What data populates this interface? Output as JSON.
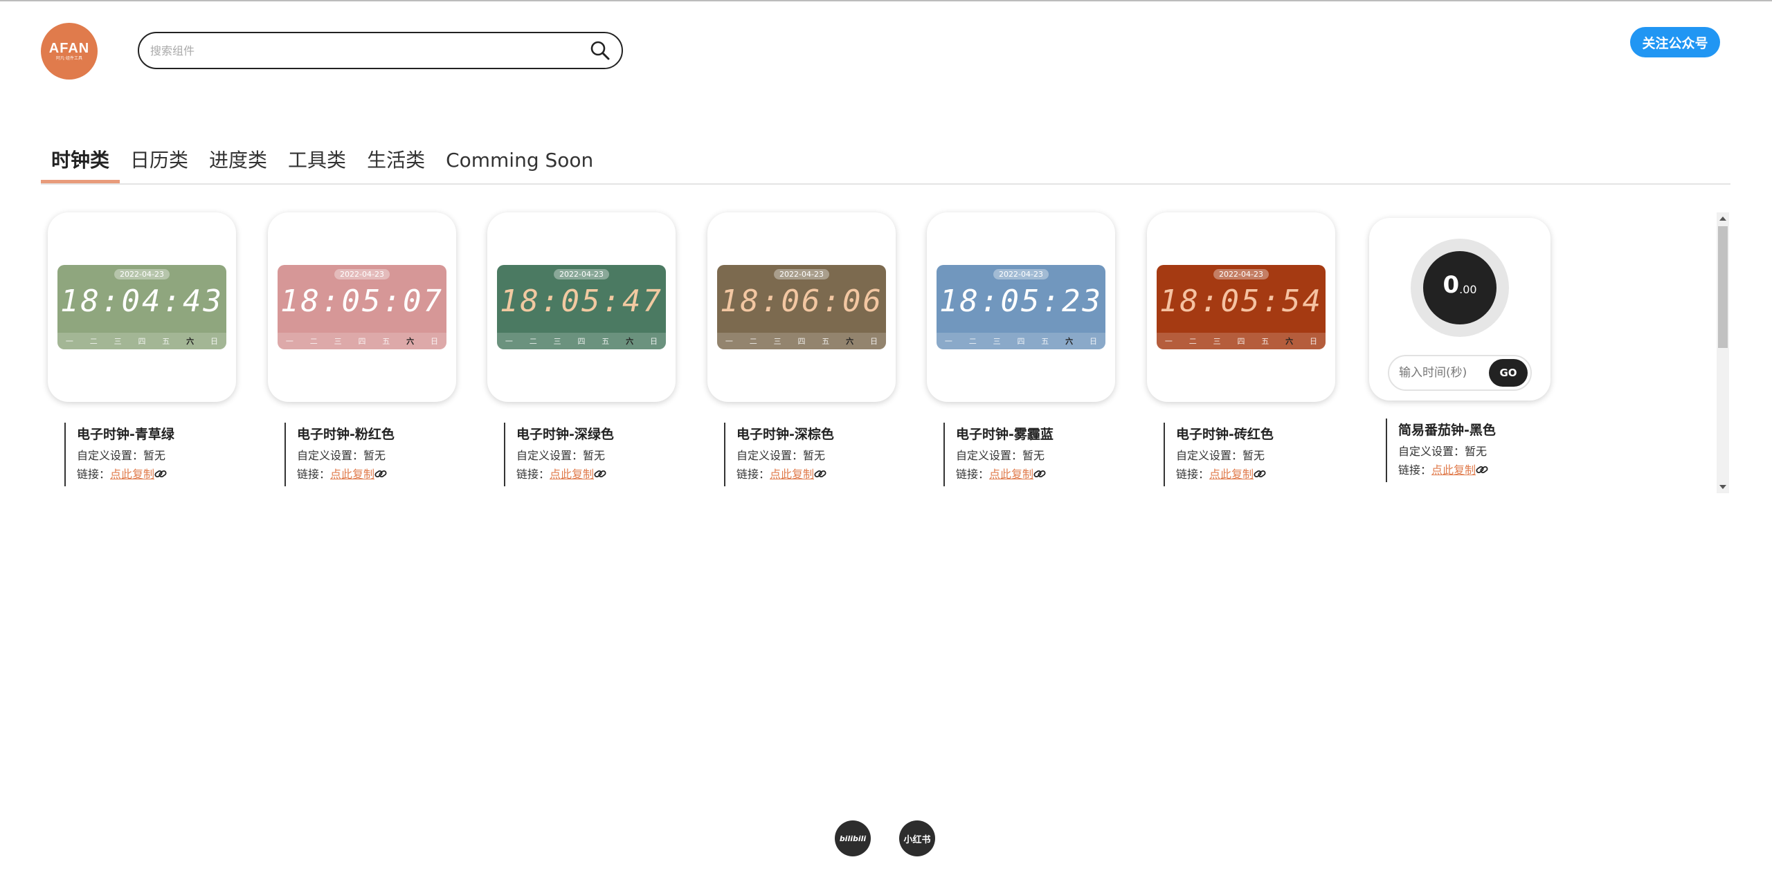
{
  "logo": {
    "text": "AFAN",
    "subtext": "阿凡·组件工具"
  },
  "search": {
    "placeholder": "搜索组件"
  },
  "header": {
    "follow_label": "关注公众号"
  },
  "tabs": [
    {
      "label": "时钟类",
      "active": true
    },
    {
      "label": "日历类"
    },
    {
      "label": "进度类"
    },
    {
      "label": "工具类"
    },
    {
      "label": "生活类"
    },
    {
      "label": "Comming Soon"
    }
  ],
  "cards": [
    {
      "title": "电子时钟-青草绿",
      "setting_label": "自定义设置：",
      "setting_value": "暂无",
      "link_label": "链接：",
      "link_text": "点此复制",
      "date": "2022-04-23",
      "time": "18:04:43",
      "bg": "#8fa67e",
      "digit_color": "#ffffff",
      "highlight_day": 5
    },
    {
      "title": "电子时钟-粉红色",
      "setting_label": "自定义设置：",
      "setting_value": "暂无",
      "link_label": "链接：",
      "link_text": "点此复制",
      "date": "2022-04-23",
      "time": "18:05:07",
      "bg": "#d69797",
      "digit_color": "#ffffff",
      "highlight_day": 5
    },
    {
      "title": "电子时钟-深绿色",
      "setting_label": "自定义设置：",
      "setting_value": "暂无",
      "link_label": "链接：",
      "link_text": "点此复制",
      "date": "2022-04-23",
      "time": "18:05:47",
      "bg": "#4b7a62",
      "digit_color": "#f2c9a1",
      "highlight_day": 5
    },
    {
      "title": "电子时钟-深棕色",
      "setting_label": "自定义设置：",
      "setting_value": "暂无",
      "link_label": "链接：",
      "link_text": "点此复制",
      "date": "2022-04-23",
      "time": "18:06:06",
      "bg": "#7c6a4f",
      "digit_color": "#f3c7a2",
      "highlight_day": 5
    },
    {
      "title": "电子时钟-雾霾蓝",
      "setting_label": "自定义设置：",
      "setting_value": "暂无",
      "link_label": "链接：",
      "link_text": "点此复制",
      "date": "2022-04-23",
      "time": "18:05:23",
      "bg": "#7197be",
      "digit_color": "#ffffff",
      "highlight_day": 5
    },
    {
      "title": "电子时钟-砖红色",
      "setting_label": "自定义设置：",
      "setting_value": "暂无",
      "link_label": "链接：",
      "link_text": "点此复制",
      "date": "2022-04-23",
      "time": "18:05:54",
      "bg": "#a53a12",
      "digit_color": "#f5c2a2",
      "highlight_day": 5
    }
  ],
  "weekdays": [
    "一",
    "二",
    "三",
    "四",
    "五",
    "六",
    "日"
  ],
  "pomodoro": {
    "title": "简易番茄钟-黑色",
    "setting_label": "自定义设置：",
    "setting_value": "暂无",
    "link_label": "链接：",
    "link_text": "点此复制",
    "value": "0",
    "decimal": ".00",
    "input_placeholder": "输入时间(秒)",
    "go_label": "GO"
  },
  "footer": {
    "bilibili": "bilibili",
    "xiaohongshu": "小红书"
  }
}
